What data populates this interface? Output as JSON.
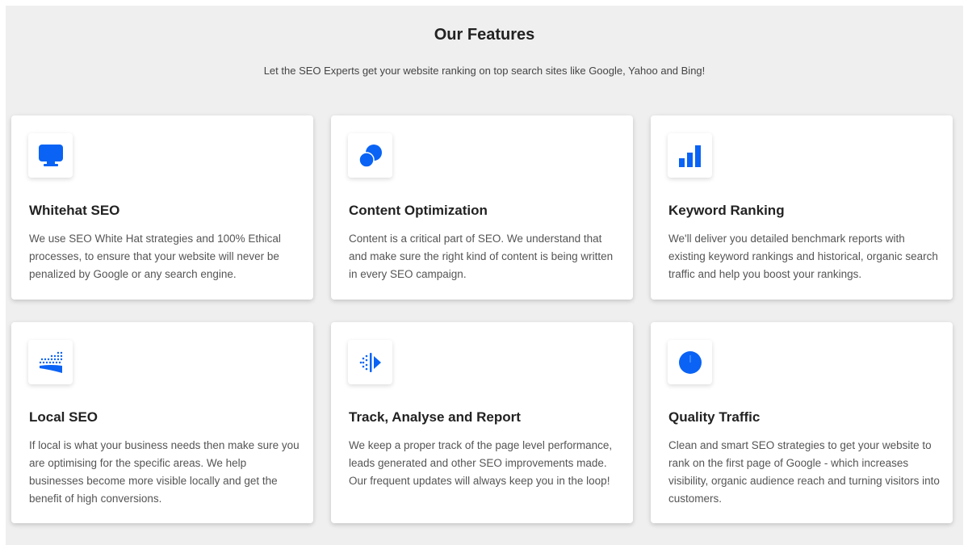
{
  "header": {
    "title": "Our Features",
    "subtitle": "Let the SEO Experts get your website ranking on top search sites like Google, Yahoo and Bing!"
  },
  "accent_color": "#0a63f5",
  "features": [
    {
      "icon": "monitor-icon",
      "title": "Whitehat SEO",
      "description": "We use SEO White Hat strategies and 100% Ethical processes, to ensure that your website will never be penalized by Google or any search engine."
    },
    {
      "icon": "overlapping-circles-icon",
      "title": "Content Optimization",
      "description": "Content is a critical part of SEO. We understand that and make sure the right kind of content is being written in every SEO campaign."
    },
    {
      "icon": "bar-chart-icon",
      "title": "Keyword Ranking",
      "description": "We'll deliver you detailed benchmark reports with existing keyword rankings and historical, organic search traffic and help you boost your rankings."
    },
    {
      "icon": "dotted-wave-icon",
      "title": "Local SEO",
      "description": "If local is what your business needs then make sure you are optimising for the specific areas. We help businesses become more visible locally and get the benefit of high conversions."
    },
    {
      "icon": "play-track-icon",
      "title": "Track, Analyse and Report",
      "description": "We keep a proper track of the page level performance, leads generated and other SEO improvements made. Our frequent updates will always keep you in the loop!"
    },
    {
      "icon": "clock-icon",
      "title": "Quality Traffic",
      "description": "Clean and smart SEO strategies to get your website to rank on the first page of Google - which increases visibility, organic audience reach and turning visitors into customers."
    }
  ]
}
